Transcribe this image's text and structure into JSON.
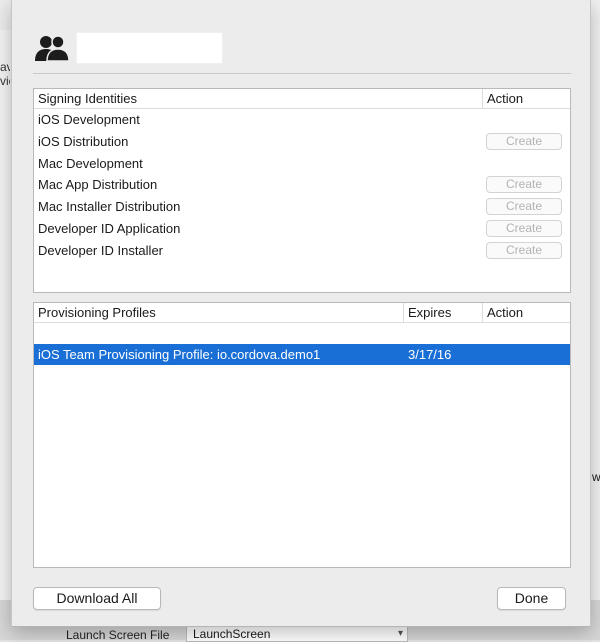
{
  "background": {
    "left_glyph_1": "av",
    "left_glyph_2": "vic",
    "right_glyph": "w",
    "launch_label": "Launch Screen File",
    "launch_value": "LaunchScreen"
  },
  "account": {
    "icon": "users-icon",
    "name_field": ""
  },
  "signing_identities": {
    "headers": {
      "name": "Signing Identities",
      "action": "Action"
    },
    "rows": [
      {
        "name": "iOS Development",
        "action": ""
      },
      {
        "name": "iOS Distribution",
        "action": "Create"
      },
      {
        "name": "Mac Development",
        "action": ""
      },
      {
        "name": "Mac App Distribution",
        "action": "Create"
      },
      {
        "name": "Mac Installer Distribution",
        "action": "Create"
      },
      {
        "name": "Developer ID Application",
        "action": "Create"
      },
      {
        "name": "Developer ID Installer",
        "action": "Create"
      }
    ]
  },
  "provisioning_profiles": {
    "headers": {
      "name": "Provisioning Profiles",
      "expires": "Expires",
      "action": "Action"
    },
    "rows": [
      {
        "name": "iOS Team Provisioning Profile: io.cordova.demo1",
        "expires": "3/17/16",
        "action": "",
        "selected": true
      }
    ]
  },
  "buttons": {
    "download_all": "Download All",
    "done": "Done"
  },
  "colors": {
    "selection": "#1a6fd6",
    "sheet_bg": "#ececec"
  }
}
